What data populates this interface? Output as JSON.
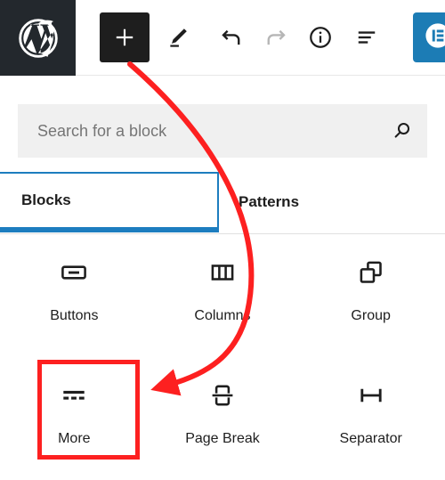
{
  "app": {
    "name": "WordPress Block Editor",
    "brand_logo": "wordpress-logo"
  },
  "colors": {
    "toolbar_logo_bg": "#23282d",
    "add_button_bg": "#1e1e1e",
    "accent_blue": "#1d7dbf",
    "elementor_blue": "#1c7cb5",
    "search_bg": "#f0f0f0",
    "annotation_red": "#fd2020",
    "text": "#1e1e1e",
    "placeholder_text": "#757575",
    "disabled_icon": "#b0b0b0"
  },
  "toolbar": {
    "items": [
      {
        "name": "wordpress-logo",
        "icon": "wordpress-icon",
        "label": "WordPress",
        "state": "default"
      },
      {
        "name": "add-block",
        "icon": "plus-icon",
        "label": "Toggle block inserter",
        "state": "active"
      },
      {
        "name": "edit-tool",
        "icon": "pencil-icon",
        "label": "Tools",
        "state": "default"
      },
      {
        "name": "undo",
        "icon": "undo-arrow-icon",
        "label": "Undo",
        "state": "default"
      },
      {
        "name": "redo",
        "icon": "redo-arrow-icon",
        "label": "Redo",
        "state": "disabled"
      },
      {
        "name": "details",
        "icon": "info-circle-icon",
        "label": "Details",
        "state": "default"
      },
      {
        "name": "list-view",
        "icon": "document-outline-icon",
        "label": "List View",
        "state": "default"
      },
      {
        "name": "elementor",
        "icon": "elementor-icon",
        "label": "Edit with Elementor",
        "state": "default"
      }
    ]
  },
  "search": {
    "placeholder": "Search for a block",
    "value": "",
    "icon": "search-icon"
  },
  "tabs": [
    {
      "id": "blocks",
      "label": "Blocks",
      "selected": true
    },
    {
      "id": "patterns",
      "label": "Patterns",
      "selected": false
    }
  ],
  "blocks": [
    {
      "id": "buttons",
      "label": "Buttons",
      "icon": "buttons-icon",
      "highlighted": false
    },
    {
      "id": "columns",
      "label": "Columns",
      "icon": "columns-icon",
      "highlighted": false
    },
    {
      "id": "group",
      "label": "Group",
      "icon": "group-icon",
      "highlighted": false
    },
    {
      "id": "more",
      "label": "More",
      "icon": "more-icon",
      "highlighted": true
    },
    {
      "id": "page-break",
      "label": "Page Break",
      "icon": "page-break-icon",
      "highlighted": false
    },
    {
      "id": "separator",
      "label": "Separator",
      "icon": "separator-icon",
      "highlighted": false
    }
  ],
  "annotations": {
    "arrow": {
      "name": "instruction-arrow",
      "color": "#fd2020",
      "from": "add-block-button",
      "to": "more-block"
    },
    "highlight_box": {
      "name": "more-block-highlight",
      "color": "#fd2020",
      "target": "more-block"
    }
  }
}
